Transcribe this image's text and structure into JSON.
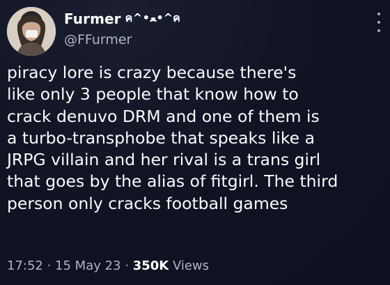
{
  "tweet": {
    "display_name": "Furmer",
    "name_emoticon": "ค^•ﻌ•^ค",
    "handle": "@FFurmer",
    "text_lines": [
      "piracy lore is crazy because there's",
      "like only 3 people that know how to",
      "crack denuvo DRM and one of them is",
      "a turbo-transphobe that speaks like a",
      "JRPG villain and her rival is a trans girl",
      "that goes by the alias of fitgirl. The third",
      "person only cracks football games"
    ],
    "meta": {
      "time": "17:52",
      "dot1": " · ",
      "date": "15 May 23",
      "dot2": " · ",
      "views_count": "350K",
      "views_label": " Views"
    }
  },
  "icons": {
    "avatar": "user-avatar",
    "more": "more-vertical-icon"
  },
  "colors": {
    "background": "#101423",
    "text": "#f3f4f6",
    "muted": "#aeb6c3"
  }
}
